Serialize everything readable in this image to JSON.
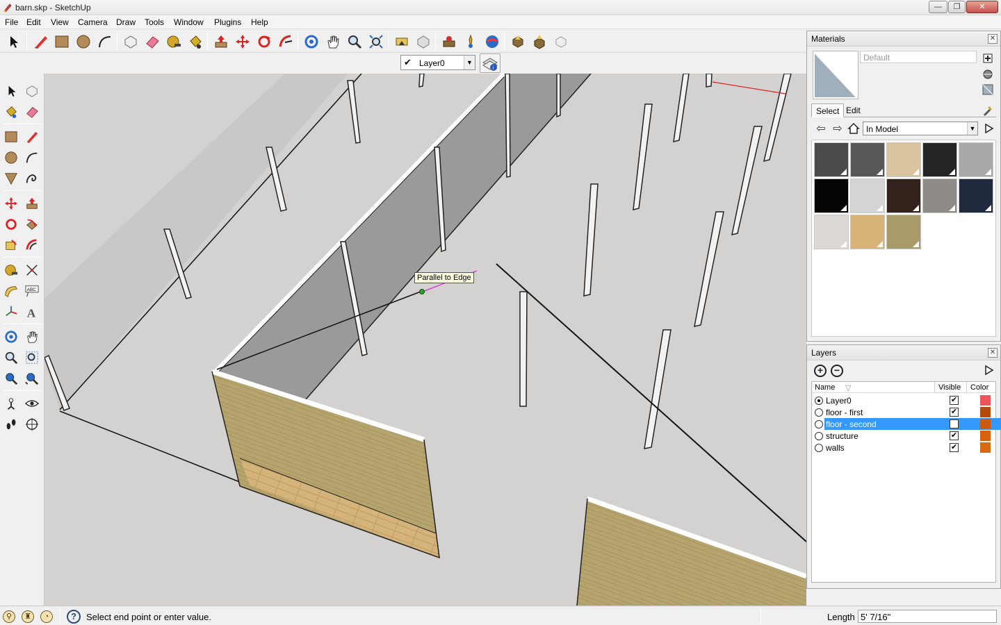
{
  "window": {
    "title": "barn.skp - SketchUp",
    "min_label": "—",
    "max_label": "❐",
    "close_label": "✕"
  },
  "menu": [
    "File",
    "Edit",
    "View",
    "Camera",
    "Draw",
    "Tools",
    "Window",
    "Plugins",
    "Help"
  ],
  "toolbar": {
    "top_icons": [
      "select-icon",
      "line-icon",
      "rectangle-icon",
      "circle-icon",
      "arc-icon",
      "make-component-icon",
      "eraser-icon",
      "tape-measure-icon",
      "paint-bucket-icon",
      "push-pull-icon",
      "move-icon",
      "rotate-icon",
      "follow-me-icon",
      "orbit-icon",
      "pan-icon",
      "zoom-icon",
      "zoom-extents-icon",
      "previous-view-icon",
      "next-view-icon",
      "add-location-icon",
      "toggle-terrain-icon",
      "google-earth-icon",
      "get-models-icon",
      "share-model-icon",
      "share-component-icon"
    ],
    "layer_check": "✔",
    "current_layer": "Layer0"
  },
  "left_toolbar": {
    "icons": [
      "select-icon",
      "make-component-icon",
      "paint-bucket-icon",
      "eraser-icon",
      "rectangle-icon",
      "line-icon",
      "circle-icon",
      "arc-icon",
      "polygon-icon",
      "freehand-icon",
      "move-icon",
      "push-pull-icon",
      "rotate-icon",
      "follow-me-icon",
      "scale-icon",
      "offset-icon",
      "tape-measure-icon",
      "dimension-icon",
      "protractor-icon",
      "text-icon",
      "axes-icon",
      "3d-text-icon",
      "orbit-icon",
      "pan-icon",
      "zoom-icon",
      "zoom-window-icon",
      "previous-icon",
      "zoom-extents-icon",
      "position-camera-icon",
      "look-around-icon",
      "walk-icon",
      "section-plane-icon"
    ]
  },
  "viewport": {
    "tooltip": "Parallel to Edge"
  },
  "materials": {
    "title": "Materials",
    "close": "✕",
    "name_placeholder": "Default",
    "tabs": {
      "select": "Select",
      "edit": "Edit"
    },
    "collection": "In Model",
    "swatches": [
      {
        "name": "dark-gray",
        "color": "#4a4a4a"
      },
      {
        "name": "medium-gray",
        "color": "#575757"
      },
      {
        "name": "tan",
        "color": "#d9c49f"
      },
      {
        "name": "charcoal",
        "color": "#242424"
      },
      {
        "name": "light-gray",
        "color": "#a8a8a8"
      },
      {
        "name": "black",
        "color": "#050505"
      },
      {
        "name": "pale-gray",
        "color": "#d4d4d4"
      },
      {
        "name": "dark-brown",
        "color": "#32221b"
      },
      {
        "name": "granite",
        "color": "#8f8a86"
      },
      {
        "name": "navy",
        "color": "#1f2a3f"
      },
      {
        "name": "stucco",
        "color": "#dcd8d4"
      },
      {
        "name": "wood-light",
        "color": "#d8b37a"
      },
      {
        "name": "wood-olive",
        "color": "#a99a6a"
      }
    ]
  },
  "layers": {
    "title": "Layers",
    "close": "✕",
    "add_label": "+",
    "remove_label": "−",
    "columns": {
      "name": "Name",
      "visible": "Visible",
      "color": "Color"
    },
    "rows": [
      {
        "name": "Layer0",
        "active": true,
        "visible": true,
        "color": "#f0545a"
      },
      {
        "name": "floor - first",
        "active": false,
        "visible": true,
        "color": "#b34b10"
      },
      {
        "name": "floor - second",
        "active": false,
        "visible": false,
        "color": "#cc5a10",
        "selected": true
      },
      {
        "name": "structure",
        "active": false,
        "visible": true,
        "color": "#d9600e"
      },
      {
        "name": "walls",
        "active": false,
        "visible": true,
        "color": "#d96a14"
      }
    ]
  },
  "status": {
    "message": "Select end point or enter value.",
    "measure_label": "Length",
    "measure_value": "5' 7/16\"",
    "icons": [
      "geo-location-icon",
      "credits-icon",
      "user-account-icon"
    ]
  }
}
